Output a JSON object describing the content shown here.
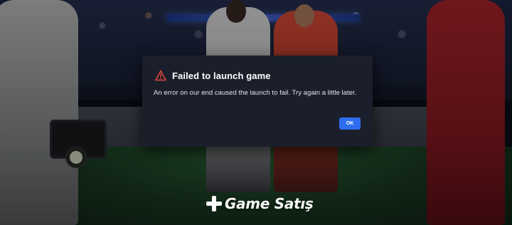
{
  "dialog": {
    "title": "Failed to launch game",
    "message": "An error on our end caused the launch to fail. Try again a little later.",
    "ok_label": "OK",
    "icon": "warning-icon",
    "accent_color": "#2f6df0",
    "warning_color": "#e0443c"
  },
  "watermark": {
    "text": "Game Satış",
    "icon": "plus-icon"
  }
}
